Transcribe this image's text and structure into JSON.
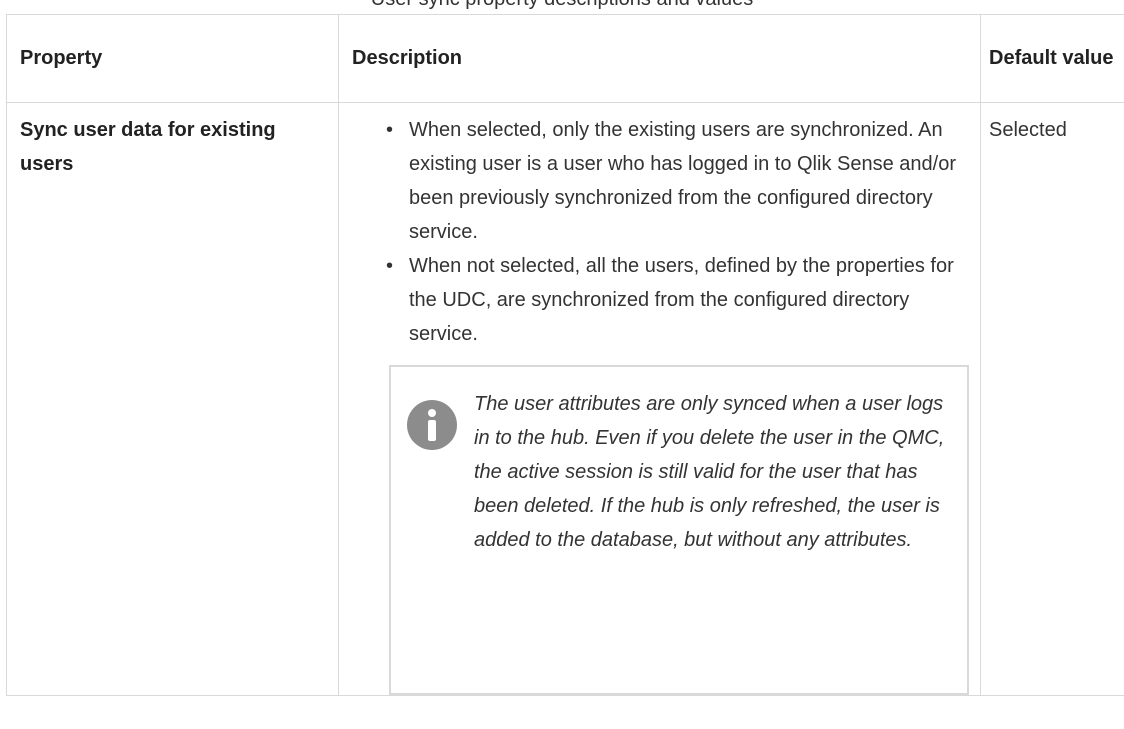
{
  "caption": "User sync property descriptions and values",
  "table": {
    "headers": {
      "property": "Property",
      "description": "Description",
      "default_value": "Default value"
    },
    "rows": [
      {
        "property": "Sync user data for existing users",
        "bullets": [
          "When selected, only the existing users are synchronized. An existing user is a user who has logged in to Qlik Sense and/or been previously synchronized from the configured directory service.",
          "When not selected, all the users, defined by the properties for the UDC, are synchronized from the configured directory service."
        ],
        "note": "The user attributes are only synced when a user logs in to the hub. Even if you delete the user in the QMC, the active session is still valid for the user that has been deleted. If the hub is only refreshed, the user is added to the database, but without any attributes.",
        "note_icon": "info-icon",
        "default_value": "Selected"
      }
    ]
  },
  "colors": {
    "border": "#d9d9d9",
    "text": "#333333",
    "icon": "#8c8c8c"
  }
}
